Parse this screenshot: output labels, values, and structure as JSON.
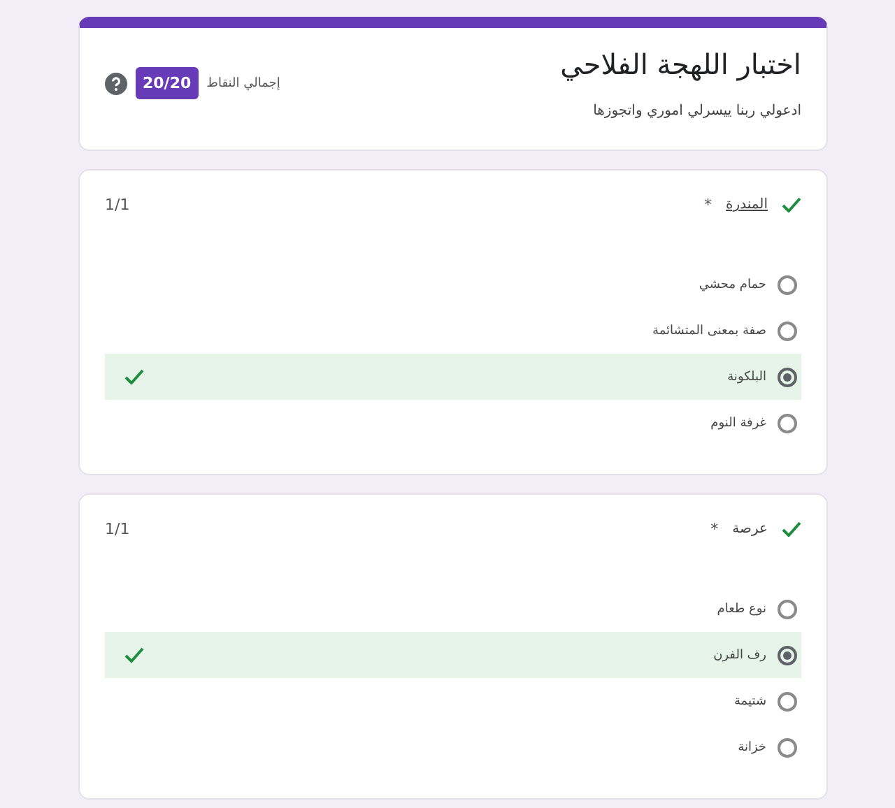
{
  "header": {
    "title": "اختبار اللهجة الفلاحي",
    "description": "ادعولي ربنا ييسرلي اموري واتجوزها",
    "points_label": "إجمالي النقاط",
    "points": "20/20"
  },
  "questions": [
    {
      "title": "المندرة",
      "required_mark": "*",
      "correct": true,
      "score": "1/1",
      "options": [
        {
          "label": "حمام محشي",
          "selected": false
        },
        {
          "label": "صفة بمعنى المتشائمة",
          "selected": false
        },
        {
          "label": "البلكونة",
          "selected": true
        },
        {
          "label": "غرفة النوم",
          "selected": false
        }
      ]
    },
    {
      "title": "عرصة",
      "required_mark": "*",
      "correct": true,
      "score": "1/1",
      "options": [
        {
          "label": "نوع طعام",
          "selected": false
        },
        {
          "label": "رف الفرن",
          "selected": true
        },
        {
          "label": "شتيمة",
          "selected": false
        },
        {
          "label": "خزانة",
          "selected": false
        }
      ]
    }
  ]
}
